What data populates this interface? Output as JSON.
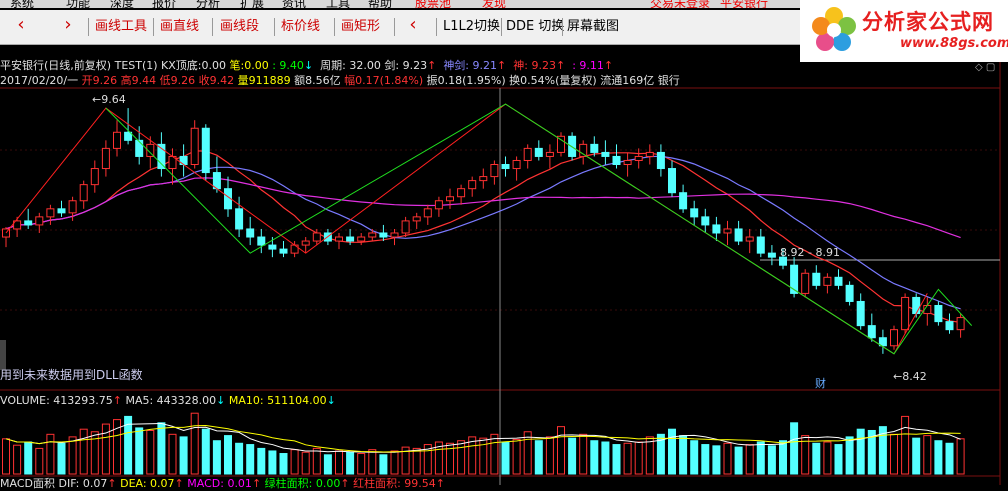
{
  "menubar": {
    "items": [
      "系统",
      "功能",
      "深度",
      "报价",
      "分析",
      "扩展",
      "资讯",
      "工具",
      "帮助"
    ],
    "box_label": "股票池",
    "discover": "发现",
    "login": "交易未登录",
    "bank": "平安银行"
  },
  "toolbar": {
    "prev": "‹",
    "next": "›",
    "tools": [
      "画线工具",
      "画直线",
      "画线段",
      "标价线",
      "画矩形"
    ],
    "back": "‹",
    "l1l2": "L1L2切换",
    "dde": "DDE 切换",
    "screenshot": "屏幕截图"
  },
  "logo": {
    "title": "分析家公式网",
    "url": "www.88gs.com"
  },
  "header": {
    "stock": "平安银行(日线,前复权)",
    "test": "TEST(1)",
    "kx_label": "KX顶底:",
    "kx_value": "0.00",
    "bi_label": "笔:",
    "bi_value": "0.00",
    "bi_value2": ": 9.40",
    "period_label": "周期:",
    "period_value": "32.00",
    "jian_label": "剑:",
    "jian_value": "9.23",
    "shenjian_label": "神剑:",
    "shenjian_value": "9.21",
    "shen_label": "神:",
    "shen_value": "9.23",
    "last_value": ": 9.11"
  },
  "quote": {
    "date": "2017/02/20/一",
    "open": "开9.26",
    "high": "高9.44",
    "low": "低9.26",
    "close": "收9.42",
    "volume": "量911889",
    "amount": "额8.56亿",
    "change": "幅0.17(1.84%)",
    "swing": "振0.18(1.95%)",
    "turnover": "换0.54%(量复权)",
    "float": "流通169亿",
    "sector": "银行"
  },
  "chart_labels": {
    "high_price": "9.64",
    "low_price": "8.42",
    "range": "8.92 - 8.91",
    "cai": "财",
    "notice": "用到未来数据用到DLL函数"
  },
  "volume": {
    "label": "VOLUME: 413293.75",
    "ma5": "MA5: 443328.00",
    "ma10": "MA10: 511104.00"
  },
  "macd": {
    "label": "MACD面积",
    "dif": "DIF: 0.07",
    "dea": "DEA: 0.07",
    "macd": "MACD: 0.01",
    "green": "绿柱面积: 0.00",
    "red": "红柱面积: 99.54"
  },
  "colors": {
    "up": "#ff3232",
    "down": "#54ffff",
    "ma_red": "#ff3333",
    "ma_blue": "#7a7aff",
    "ma_mag": "#e030e0",
    "zig_red": "#ff2020",
    "zig_green": "#20e020"
  },
  "chart_data": {
    "type": "candlestick",
    "price_range": [
      8.3,
      9.72
    ],
    "candles": [
      [
        9.0,
        9.05,
        8.95,
        9.04
      ],
      [
        9.04,
        9.1,
        9.0,
        9.08
      ],
      [
        9.08,
        9.14,
        9.04,
        9.06
      ],
      [
        9.06,
        9.12,
        9.02,
        9.1
      ],
      [
        9.1,
        9.16,
        9.06,
        9.14
      ],
      [
        9.14,
        9.18,
        9.1,
        9.12
      ],
      [
        9.12,
        9.2,
        9.08,
        9.18
      ],
      [
        9.18,
        9.28,
        9.14,
        9.26
      ],
      [
        9.26,
        9.38,
        9.22,
        9.34
      ],
      [
        9.34,
        9.48,
        9.3,
        9.44
      ],
      [
        9.44,
        9.58,
        9.4,
        9.52
      ],
      [
        9.52,
        9.64,
        9.46,
        9.48
      ],
      [
        9.48,
        9.55,
        9.36,
        9.4
      ],
      [
        9.4,
        9.5,
        9.34,
        9.46
      ],
      [
        9.46,
        9.52,
        9.3,
        9.34
      ],
      [
        9.34,
        9.44,
        9.26,
        9.4
      ],
      [
        9.4,
        9.46,
        9.3,
        9.36
      ],
      [
        9.36,
        9.58,
        9.34,
        9.54
      ],
      [
        9.54,
        9.56,
        9.28,
        9.32
      ],
      [
        9.32,
        9.4,
        9.22,
        9.24
      ],
      [
        9.24,
        9.3,
        9.1,
        9.14
      ],
      [
        9.14,
        9.2,
        9.0,
        9.04
      ],
      [
        9.04,
        9.1,
        8.96,
        9.0
      ],
      [
        9.0,
        9.04,
        8.92,
        8.96
      ],
      [
        8.96,
        9.0,
        8.9,
        8.94
      ],
      [
        8.94,
        8.98,
        8.9,
        8.92
      ],
      [
        8.92,
        8.98,
        8.9,
        8.96
      ],
      [
        8.96,
        9.0,
        8.92,
        8.98
      ],
      [
        8.98,
        9.04,
        8.96,
        9.02
      ],
      [
        9.02,
        9.04,
        8.96,
        8.98
      ],
      [
        8.98,
        9.02,
        8.94,
        9.0
      ],
      [
        9.0,
        9.04,
        8.96,
        8.98
      ],
      [
        8.98,
        9.02,
        8.96,
        9.0
      ],
      [
        9.0,
        9.04,
        8.98,
        9.02
      ],
      [
        9.02,
        9.06,
        8.98,
        9.0
      ],
      [
        9.0,
        9.04,
        8.96,
        9.02
      ],
      [
        9.02,
        9.1,
        9.0,
        9.08
      ],
      [
        9.08,
        9.12,
        9.04,
        9.1
      ],
      [
        9.1,
        9.16,
        9.06,
        9.14
      ],
      [
        9.14,
        9.2,
        9.1,
        9.18
      ],
      [
        9.18,
        9.24,
        9.14,
        9.2
      ],
      [
        9.2,
        9.26,
        9.16,
        9.24
      ],
      [
        9.24,
        9.3,
        9.2,
        9.28
      ],
      [
        9.28,
        9.34,
        9.24,
        9.3
      ],
      [
        9.3,
        9.38,
        9.26,
        9.36
      ],
      [
        9.36,
        9.4,
        9.3,
        9.34
      ],
      [
        9.34,
        9.4,
        9.28,
        9.38
      ],
      [
        9.38,
        9.46,
        9.34,
        9.44
      ],
      [
        9.44,
        9.48,
        9.38,
        9.4
      ],
      [
        9.4,
        9.46,
        9.34,
        9.42
      ],
      [
        9.42,
        9.52,
        9.4,
        9.5
      ],
      [
        9.5,
        9.52,
        9.38,
        9.4
      ],
      [
        9.4,
        9.48,
        9.36,
        9.46
      ],
      [
        9.46,
        9.5,
        9.4,
        9.42
      ],
      [
        9.42,
        9.48,
        9.36,
        9.4
      ],
      [
        9.4,
        9.46,
        9.34,
        9.36
      ],
      [
        9.36,
        9.42,
        9.3,
        9.38
      ],
      [
        9.38,
        9.44,
        9.34,
        9.4
      ],
      [
        9.4,
        9.46,
        9.36,
        9.42
      ],
      [
        9.42,
        9.46,
        9.3,
        9.34
      ],
      [
        9.34,
        9.38,
        9.2,
        9.22
      ],
      [
        9.22,
        9.26,
        9.12,
        9.14
      ],
      [
        9.14,
        9.18,
        9.06,
        9.1
      ],
      [
        9.1,
        9.14,
        9.02,
        9.06
      ],
      [
        9.06,
        9.1,
        8.98,
        9.02
      ],
      [
        9.02,
        9.08,
        8.96,
        9.04
      ],
      [
        9.04,
        9.08,
        8.96,
        8.98
      ],
      [
        8.98,
        9.04,
        8.92,
        9.0
      ],
      [
        9.0,
        9.04,
        8.9,
        8.92
      ],
      [
        8.92,
        8.96,
        8.86,
        8.9
      ],
      [
        8.9,
        8.94,
        8.84,
        8.86
      ],
      [
        8.86,
        8.9,
        8.7,
        8.72
      ],
      [
        8.72,
        8.84,
        8.7,
        8.82
      ],
      [
        8.82,
        8.86,
        8.74,
        8.76
      ],
      [
        8.76,
        8.82,
        8.72,
        8.8
      ],
      [
        8.8,
        8.84,
        8.74,
        8.76
      ],
      [
        8.76,
        8.78,
        8.66,
        8.68
      ],
      [
        8.68,
        8.72,
        8.54,
        8.56
      ],
      [
        8.56,
        8.62,
        8.48,
        8.5
      ],
      [
        8.5,
        8.54,
        8.42,
        8.46
      ],
      [
        8.46,
        8.56,
        8.44,
        8.54
      ],
      [
        8.54,
        8.72,
        8.52,
        8.7
      ],
      [
        8.7,
        8.72,
        8.6,
        8.62
      ],
      [
        8.62,
        8.7,
        8.56,
        8.66
      ],
      [
        8.66,
        8.68,
        8.56,
        8.58
      ],
      [
        8.58,
        8.62,
        8.52,
        8.54
      ],
      [
        8.54,
        8.62,
        8.5,
        8.6
      ]
    ],
    "volume": [
      0.55,
      0.45,
      0.5,
      0.4,
      0.62,
      0.48,
      0.58,
      0.7,
      0.66,
      0.78,
      0.85,
      0.9,
      0.72,
      0.68,
      0.8,
      0.62,
      0.58,
      0.95,
      0.7,
      0.52,
      0.6,
      0.48,
      0.46,
      0.4,
      0.36,
      0.32,
      0.38,
      0.34,
      0.4,
      0.3,
      0.36,
      0.34,
      0.32,
      0.38,
      0.3,
      0.36,
      0.42,
      0.4,
      0.46,
      0.5,
      0.48,
      0.52,
      0.58,
      0.56,
      0.62,
      0.5,
      0.54,
      0.66,
      0.52,
      0.58,
      0.74,
      0.56,
      0.62,
      0.52,
      0.5,
      0.46,
      0.48,
      0.5,
      0.58,
      0.62,
      0.7,
      0.6,
      0.52,
      0.46,
      0.44,
      0.48,
      0.42,
      0.46,
      0.5,
      0.44,
      0.52,
      0.8,
      0.6,
      0.48,
      0.5,
      0.46,
      0.58,
      0.7,
      0.68,
      0.74,
      0.62,
      0.9,
      0.56,
      0.6,
      0.52,
      0.48,
      0.55
    ]
  }
}
